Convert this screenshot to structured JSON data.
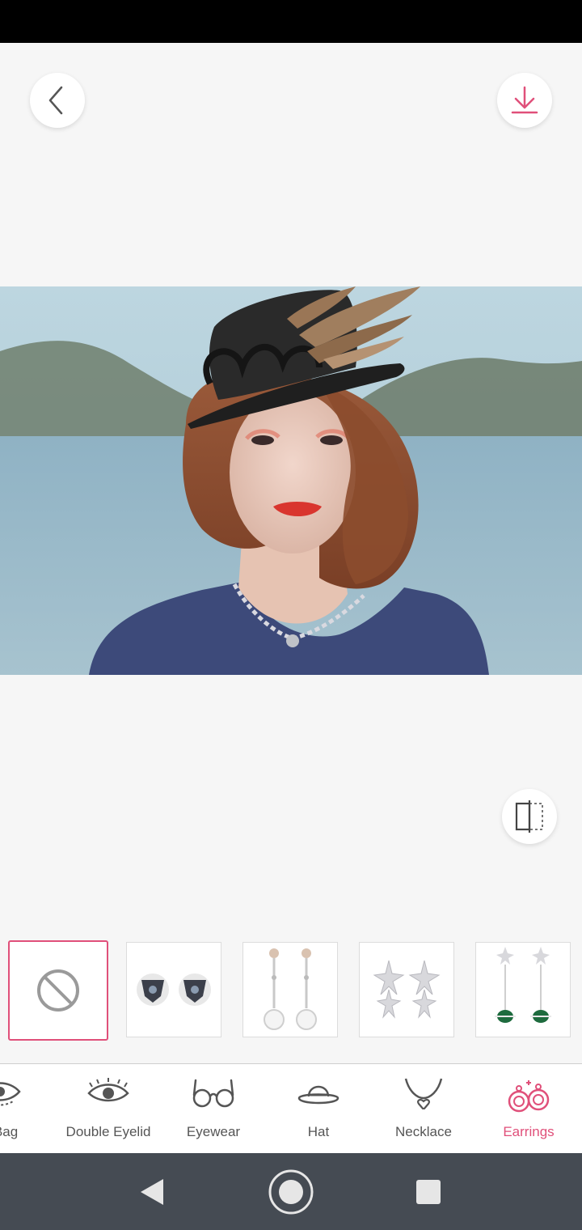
{
  "header": {
    "back_icon": "chevron-left-icon",
    "download_icon": "download-icon"
  },
  "compare_icon": "compare-split-icon",
  "thumbnails": [
    {
      "name": "none",
      "icon": "no-symbol-icon",
      "selected": true
    },
    {
      "name": "shield-stud-earrings",
      "icon": "earring-stud-icon"
    },
    {
      "name": "pearl-drop-earrings",
      "icon": "earring-drop-icon"
    },
    {
      "name": "star-cluster-earrings",
      "icon": "earring-star-icon"
    },
    {
      "name": "emerald-drop-earrings",
      "icon": "earring-emerald-icon"
    }
  ],
  "tabs": [
    {
      "label": "e Bag",
      "icon": "eye-bag-icon"
    },
    {
      "label": "Double Eyelid",
      "icon": "eye-icon"
    },
    {
      "label": "Eyewear",
      "icon": "glasses-icon"
    },
    {
      "label": "Hat",
      "icon": "hat-icon"
    },
    {
      "label": "Necklace",
      "icon": "necklace-icon"
    },
    {
      "label": "Earrings",
      "icon": "earrings-icon",
      "active": true
    }
  ],
  "colors": {
    "accent": "#e0507a",
    "background": "#f6f6f6",
    "navbar": "#454b53"
  }
}
